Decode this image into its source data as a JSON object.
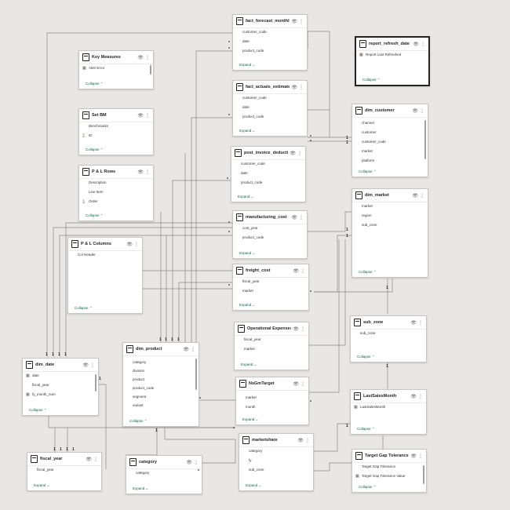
{
  "tables": {
    "fact_forecast_monthly": {
      "title": "fact_forecast_monthly",
      "fields": [
        "customer_code",
        "date",
        "product_code"
      ],
      "footer": "Expand"
    },
    "fact_actuals_estimates": {
      "title": "fact_actuals_estimates",
      "fields": [
        "customer_code",
        "date",
        "product_code"
      ],
      "footer": "Expand"
    },
    "post_invoice": {
      "title": "post_invoice_deducti...",
      "fields": [
        "customer_code",
        "date",
        "product_code"
      ],
      "footer": "Expand"
    },
    "manufacturing_cost": {
      "title": "manufacturing_cost",
      "fields": [
        "cost_year",
        "product_code"
      ],
      "footer": "Expand"
    },
    "freight_cost": {
      "title": "freight_cost",
      "fields": [
        "fiscal_year",
        "market"
      ],
      "footer": "Expand"
    },
    "operational_expenses": {
      "title": "Operational Expenses",
      "fields": [
        "fiscal_year",
        "market"
      ],
      "footer": "Expand"
    },
    "nsgmtarget": {
      "title": "NsGmTarget",
      "fields": [
        "market",
        "month"
      ],
      "footer": "Expand"
    },
    "marketshare": {
      "title": "marketshare",
      "fields": [
        "category",
        "fy",
        "sub_zone"
      ],
      "footer": "Expand"
    },
    "category": {
      "title": "category",
      "fields": [
        "category"
      ],
      "footer": "Expand"
    },
    "fiscal_year": {
      "title": "fiscal_year",
      "fields": [
        "fiscal_year"
      ],
      "footer": "Expand"
    },
    "dim_date": {
      "title": "dim_date",
      "fields": [
        "date",
        "fiscal_year",
        "fy_month_num"
      ],
      "footer": "Collapse"
    },
    "dim_product": {
      "title": "dim_product",
      "fields": [
        "category",
        "division",
        "product",
        "product_code",
        "segment",
        "variant"
      ],
      "footer": "Collapse"
    },
    "key_measures": {
      "title": "Key Measures",
      "fields": [
        "ABS Error"
      ],
      "footer": "Collapse"
    },
    "set_bm": {
      "title": "Set BM",
      "fields": [
        "Benchmarks",
        "ID"
      ],
      "footer": "Collapse"
    },
    "pl_rows": {
      "title": "P & L Rows",
      "fields": [
        "Description",
        "Line Item",
        "Order"
      ],
      "footer": "Collapse"
    },
    "pl_columns": {
      "title": "P & L Columns",
      "fields": [
        "Col Header"
      ],
      "footer": "Collapse"
    },
    "report_refresh_date": {
      "title": "report_refresh_date",
      "fields": [
        "Report Last Refreshed"
      ],
      "footer": "Collapse"
    },
    "dim_customer": {
      "title": "dim_customer",
      "fields": [
        "channel",
        "customer",
        "customer_code",
        "market",
        "platform"
      ],
      "footer": "Collapse"
    },
    "dim_market": {
      "title": "dim_market",
      "fields": [
        "market",
        "region",
        "sub_zone"
      ],
      "footer": "Collapse"
    },
    "sub_zone": {
      "title": "sub_zone",
      "fields": [
        "sub_zone"
      ],
      "footer": "Collapse"
    },
    "last_sales_month": {
      "title": "LastSalesMonth",
      "fields": [
        "LastSalesMonth"
      ],
      "footer": "Collapse"
    },
    "target_gap_tolerance": {
      "title": "Target Gap Tolerance",
      "fields": [
        "Target Gap Tolerance",
        "Target Gap Tolerance Value"
      ],
      "footer": "Collapse"
    }
  },
  "icons": {
    "visibility": "eye-icon",
    "more": "more-options-icon",
    "table": "table-icon",
    "measure": "calculator-icon",
    "sigma": "sigma-icon"
  },
  "markers": {
    "one": "1",
    "many": "*"
  }
}
